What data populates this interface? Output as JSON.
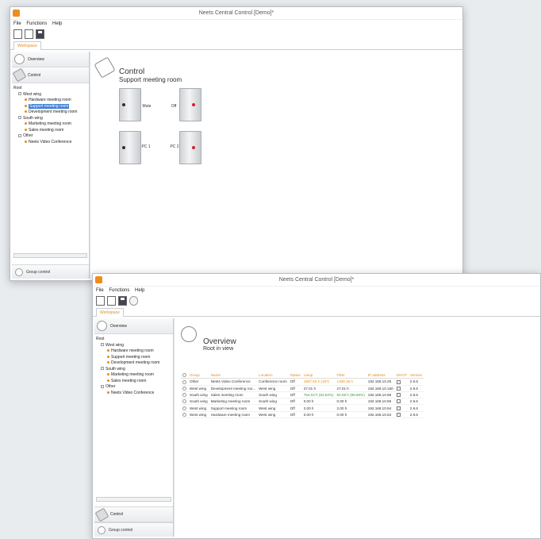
{
  "window1": {
    "title": "Neets Central Control [Demo]*",
    "menu": [
      "File",
      "Functions",
      "Help"
    ],
    "tab": "Workspace",
    "nav": {
      "overview": "Overview",
      "control": "Control"
    },
    "tree": {
      "root": "Root",
      "groups": [
        {
          "name": "West wing",
          "items": [
            "Hardware meeting room",
            "Support meeting room",
            "Development meeting room"
          ]
        },
        {
          "name": "South wing",
          "items": [
            "Marketing meeting room",
            "Sales meeting room"
          ]
        },
        {
          "name": "Other",
          "items": [
            "Neets Video Conference"
          ]
        }
      ],
      "selected": "Support meeting room"
    },
    "group_control": "Group control",
    "pane": {
      "title": "Control",
      "subtitle": "Support meeting room",
      "buttons": [
        {
          "label": "Mute",
          "state": "off"
        },
        {
          "label": "Off",
          "state": "on"
        },
        {
          "label": "PC 1",
          "state": "off"
        },
        {
          "label": "PC 2",
          "state": "off"
        }
      ]
    }
  },
  "window2": {
    "title": "Neets Central Control [Demo]*",
    "menu": [
      "File",
      "Functions",
      "Help"
    ],
    "tab": "Workspace",
    "nav": {
      "overview": "Overview",
      "control": "Control",
      "group_control": "Group control"
    },
    "tree": {
      "root": "Root",
      "groups": [
        {
          "name": "West wing",
          "items": [
            "Hardware meeting room",
            "Support meeting room",
            "Development meeting room"
          ]
        },
        {
          "name": "South wing",
          "items": [
            "Marketing meeting room",
            "Sales meeting room"
          ]
        },
        {
          "name": "Other",
          "items": [
            "Neets Video Conference"
          ]
        }
      ]
    },
    "pane": {
      "title": "Overview",
      "subtitle": "Root in view",
      "columns": [
        "Group",
        "Name",
        "Location",
        "Status",
        "Lamp",
        "Filter",
        "IP address",
        "DHCP",
        "Version"
      ],
      "rows": [
        {
          "group": "Other",
          "name": "Neets Video Conference",
          "location": "Conference room",
          "status": "Off",
          "lamp": "1567.63 h (157)",
          "filter": "1308.36 h",
          "ip": "192.168.10.25",
          "version": "2.9.6",
          "lamp_color": "#e88a1a"
        },
        {
          "group": "West wing",
          "name": "Development meeting roo...",
          "location": "West wing",
          "status": "Off",
          "lamp": "27.01 h",
          "filter": "27.01 h",
          "ip": "192.168.10.150",
          "version": "2.9.6",
          "lamp_color": ""
        },
        {
          "group": "South wing",
          "name": "Sales meeting room",
          "location": "South wing",
          "status": "Off",
          "lamp": "754.03 h (83.82%)",
          "filter": "50.08 h (96.80%)",
          "ip": "192.168.10.96",
          "version": "2.9.6",
          "lamp_color": "#3c9a3c"
        },
        {
          "group": "South wing",
          "name": "Marketing meeting room",
          "location": "South wing",
          "status": "Off",
          "lamp": "0.00 h",
          "filter": "0.00 h",
          "ip": "192.168.10.96",
          "version": "2.9.6",
          "lamp_color": ""
        },
        {
          "group": "West wing",
          "name": "Support meeting room",
          "location": "West wing",
          "status": "Off",
          "lamp": "2.00 h",
          "filter": "2.00 h",
          "ip": "192.168.10.94",
          "version": "2.9.6",
          "lamp_color": ""
        },
        {
          "group": "West wing",
          "name": "Hardware meeting room",
          "location": "West wing",
          "status": "Off",
          "lamp": "0.00 h",
          "filter": "0.00 h",
          "ip": "192.168.10.53",
          "version": "2.9.6",
          "lamp_color": ""
        }
      ]
    }
  },
  "colors": {
    "accent": "#e88a1a",
    "selection": "#3d7fd6",
    "indicator_on": "#d92020"
  }
}
